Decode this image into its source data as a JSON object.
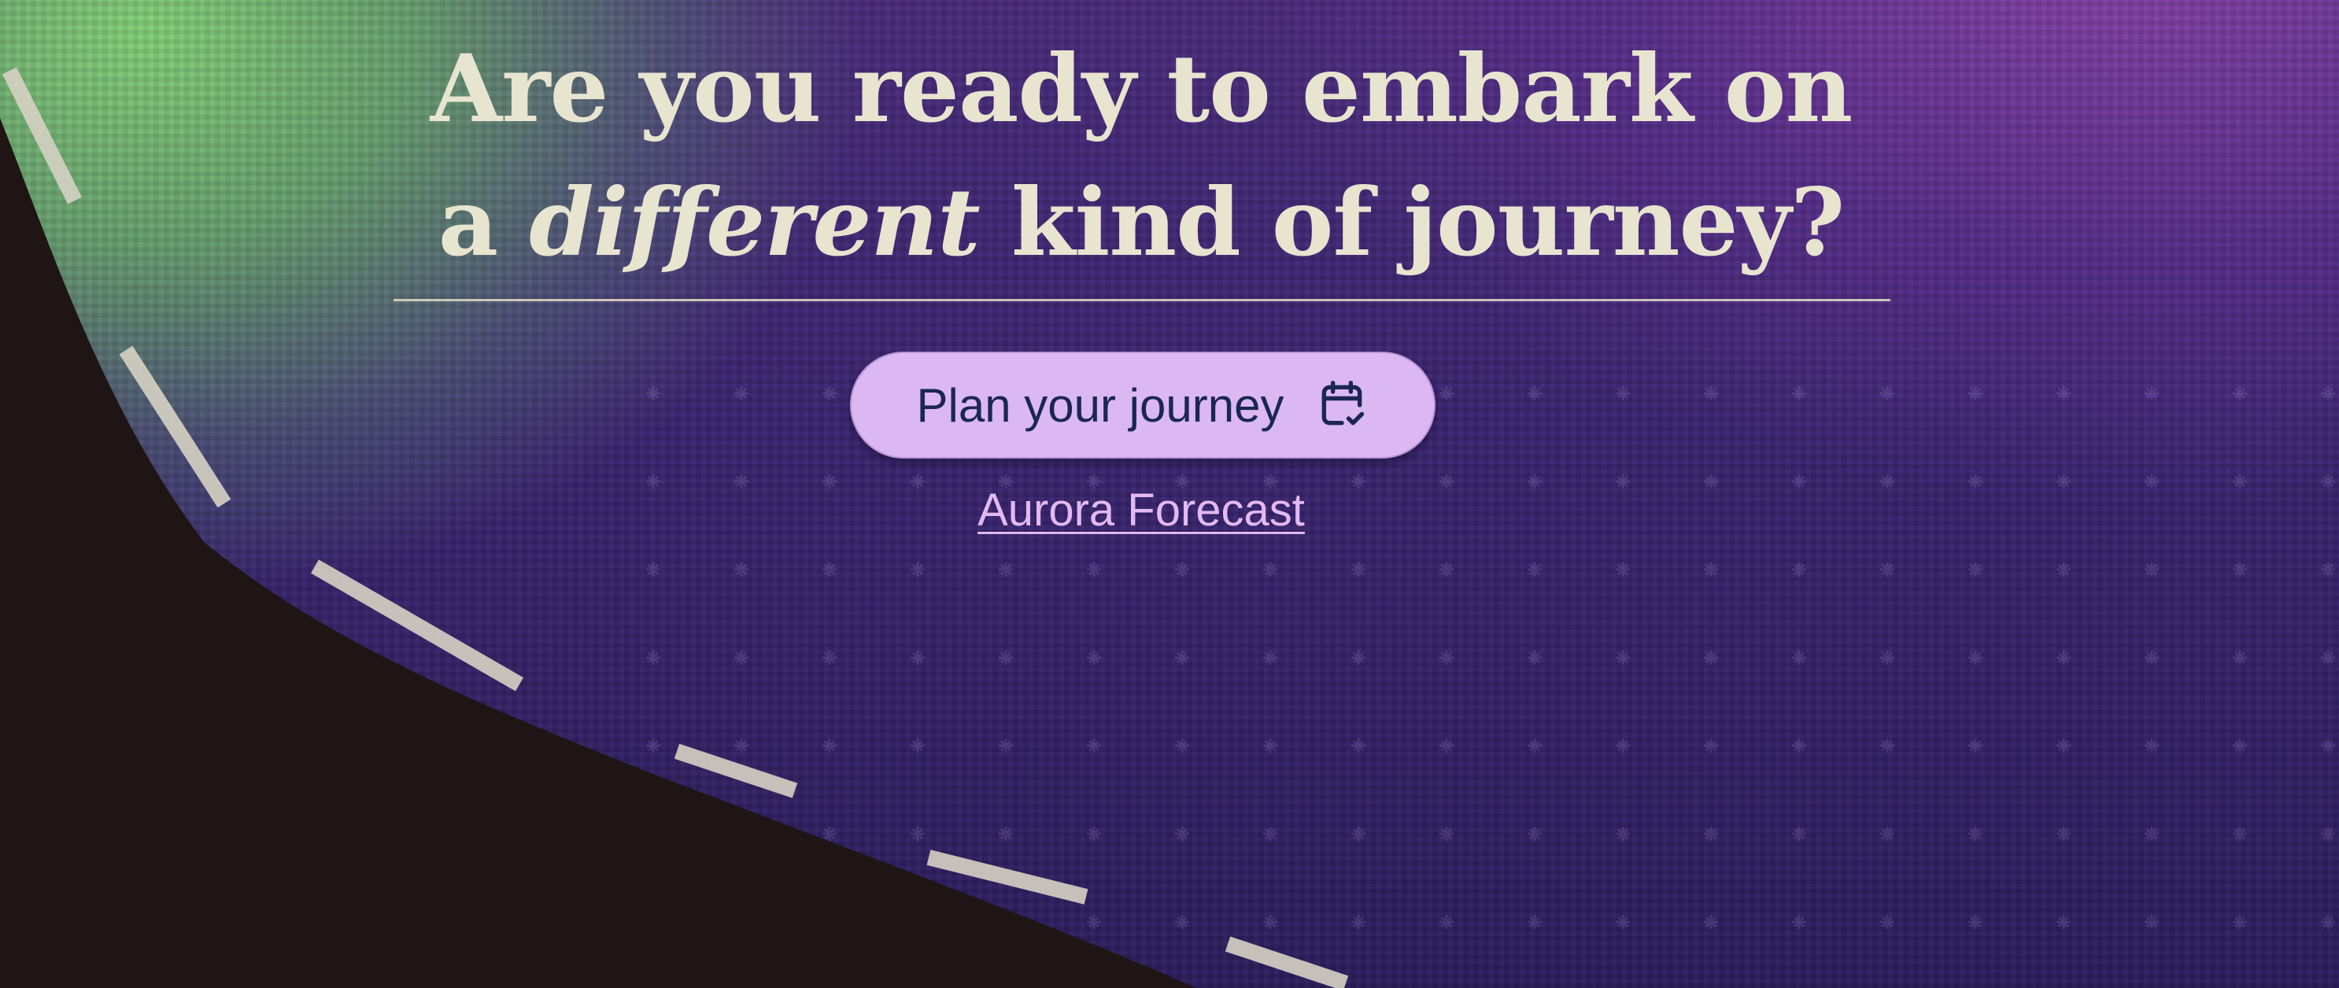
{
  "hero": {
    "headline": {
      "line1": "Are you ready to embark on",
      "line2_prefix": "a ",
      "line2_emphasis": "different",
      "line2_suffix": " kind of journey?"
    },
    "primary_button": {
      "label": "Plan your journey",
      "icon": "calendar-check-icon"
    },
    "secondary_link": {
      "label": "Aurora Forecast"
    }
  },
  "colors": {
    "headline_text": "#e7e4cf",
    "button_bg": "#dcb8f2",
    "button_text": "#1b2753",
    "link_text": "#e3b9f2",
    "aurora_green": "#84d278",
    "sky_purple": "#3a2670",
    "ground_dark": "#1f1515"
  }
}
